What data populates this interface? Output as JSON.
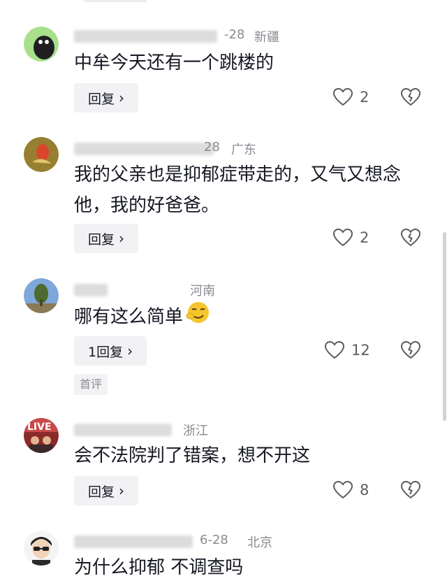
{
  "comments": [
    {
      "date": "-28",
      "location": "新疆",
      "text": "中牟今天还有一个跳楼的",
      "reply_label": "回复",
      "likes": "2"
    },
    {
      "date": "28",
      "location": "广东",
      "text": "我的父亲也是抑郁症带走的，又气又想念他，我的好爸爸。",
      "reply_label": "回复",
      "likes": "2"
    },
    {
      "date": "",
      "location": "河南",
      "text": "哪有这么简单",
      "reply_label": "1回复",
      "likes": "12",
      "tag": "首评"
    },
    {
      "date": "",
      "location": "浙江",
      "text": "会不法院判了错案，想不开这",
      "reply_label": "回复",
      "likes": "8"
    },
    {
      "date": "6-28",
      "location": "北京",
      "text": "为什么抑郁 不调查吗"
    }
  ],
  "icons": {
    "like": "heart-outline-icon",
    "dislike": "broken-heart-icon",
    "reply_chevron": "chevron-right-icon"
  }
}
